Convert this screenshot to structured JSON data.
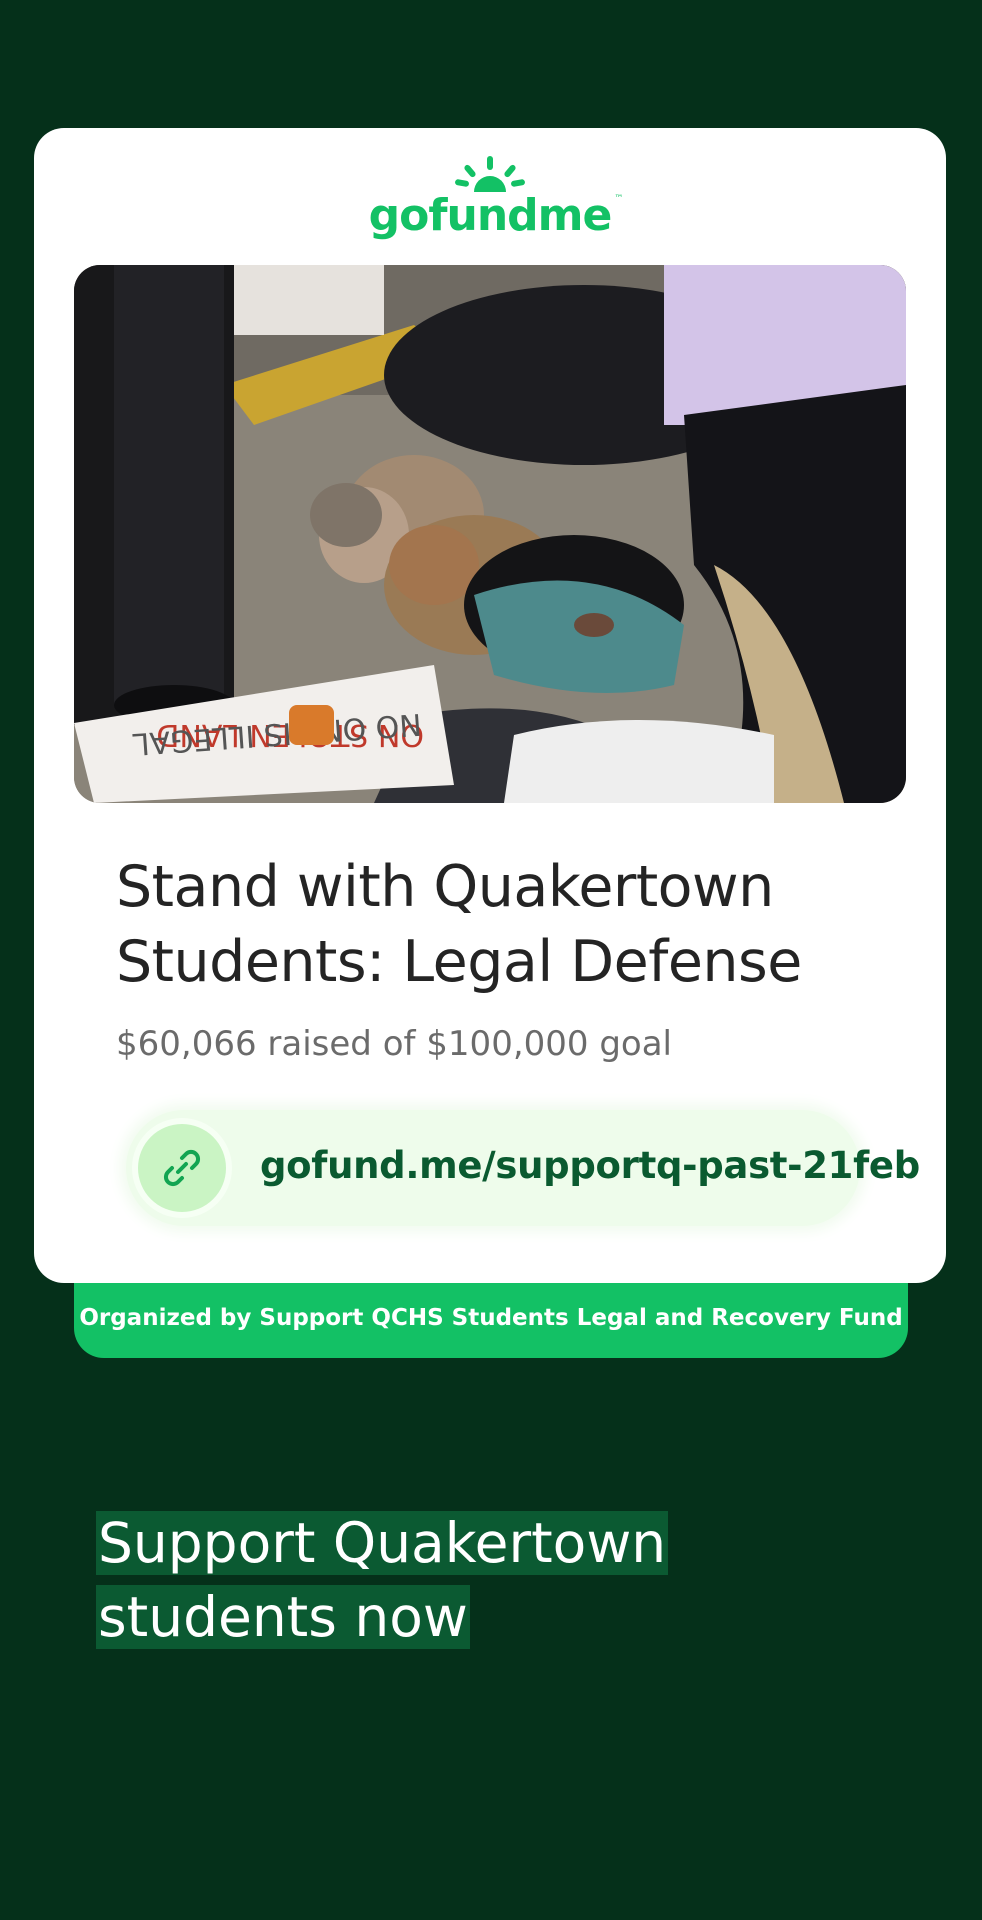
{
  "colors": {
    "background": "#05301a",
    "card": "#ffffff",
    "brand_green": "#13c165",
    "link_green": "#0a5a30",
    "highlight": "#0b5a32"
  },
  "logo": {
    "text": "gofundme",
    "trademark": "™",
    "icon": "gofundme-sun-icon"
  },
  "campaign": {
    "title_line1": "Stand with Quakertown",
    "title_line2": "Students: Legal Defense",
    "raised": "$60,066 raised",
    "of_word": "of",
    "goal": "$100,000 goal",
    "progress_fraction": 0.60066
  },
  "photo": {
    "sign_text_line1": "ON STOLEN LAND",
    "sign_text_line2": "NO ONE IS ILLEGAL"
  },
  "link": {
    "icon": "link-icon",
    "url": "gofund.me/supportq-past-21feb"
  },
  "organizer": {
    "text": "Organized by Support QCHS Students Legal and Recovery Fund"
  },
  "headline": {
    "line1": "Support Quakertown",
    "line2": "students now"
  }
}
